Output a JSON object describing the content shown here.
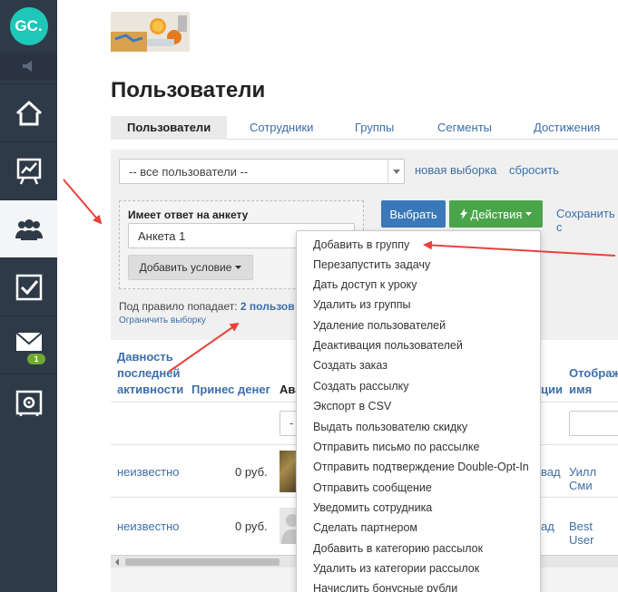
{
  "sidebar": {
    "logo": "GC.",
    "items": [
      {
        "icon": "home-icon"
      },
      {
        "icon": "chart-icon"
      },
      {
        "icon": "users-icon",
        "active": true
      },
      {
        "icon": "checkbox-icon"
      },
      {
        "icon": "mail-icon",
        "badge": "1"
      },
      {
        "icon": "safe-icon"
      }
    ]
  },
  "page": {
    "title": "Пользователи"
  },
  "tabs": [
    "Пользователи",
    "Сотрудники",
    "Группы",
    "Сегменты",
    "Достижения"
  ],
  "filter": {
    "select_value": "-- все пользователи --",
    "new_selection": "новая выборка",
    "reset": "сбросить",
    "condition_label": "Имеет ответ на анкету",
    "condition_value": "Анкета 1",
    "add_condition": "Добавить условие",
    "choose_button": "Выбрать",
    "actions_button": "Действия",
    "save_link": "Сохранить с",
    "rule_prefix": "Под правило попадает:",
    "rule_count": "2 пользов",
    "limit_link": "Ограничить выборку"
  },
  "table": {
    "headers": {
      "activity": [
        "Давность",
        "последней",
        "активности"
      ],
      "money": "Принес денег",
      "avatar": "Ава",
      "partial": "ции",
      "display": [
        "Отобража",
        "имя"
      ]
    },
    "rows": [
      {
        "activity": "неизвестно",
        "money": "0 руб.",
        "partial": "вад",
        "name": "Уилл Сми"
      },
      {
        "activity": "неизвестно",
        "money": "0 руб.",
        "partial": "ад",
        "name": "Best User"
      }
    ]
  },
  "menu": {
    "items": [
      "Добавить в группу",
      "Перезапустить задачу",
      "Дать доступ к уроку",
      "Удалить из группы",
      "Удаление пользователей",
      "Деактивация пользователей",
      "Создать заказ",
      "Создать рассылку",
      "Экспорт в CSV",
      "Выдать пользователю скидку",
      "Отправить письмо по рассылке",
      "Отправить подтверждение Double-Opt-In",
      "Отправить сообщение",
      "Уведомить сотрудника",
      "Сделать партнером",
      "Добавить в категорию рассылок",
      "Удалить из категории рассылок",
      "Начислить бонусные рубли"
    ]
  },
  "colors": {
    "sidebar": "#2f3a48",
    "logo": "#1ec7b8",
    "link": "#3c6fa8",
    "primary": "#3b78b9",
    "success": "#4aa54a",
    "arrow": "#e8413b"
  }
}
